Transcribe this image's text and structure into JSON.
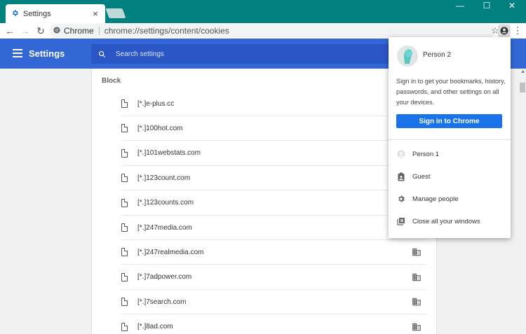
{
  "tab": {
    "title": "Settings",
    "close": "×"
  },
  "window_controls": {
    "minimize": "—",
    "maximize": "☐",
    "close": "✕"
  },
  "toolbar": {
    "back": "←",
    "forward": "→",
    "reload": "↻",
    "site_label": "Chrome",
    "url": "chrome://settings/content/cookies",
    "star": "☆",
    "menu": "⋮"
  },
  "header": {
    "title": "Settings",
    "search_placeholder": "Search settings"
  },
  "content": {
    "section_label": "Block",
    "sites": [
      "[*.]e-plus.cc",
      "[*.]100hot.com",
      "[*.]101webstats.com",
      "[*.]123count.com",
      "[*.]123counts.com",
      "[*.]247media.com",
      "[*.]247realmedia.com",
      "[*.]7adpower.com",
      "[*.]7search.com",
      "[*.]8ad.com"
    ]
  },
  "profile_popup": {
    "person_name": "Person 2",
    "signin_text": "Sign in to get your bookmarks, history, passwords, and other settings on all your devices.",
    "signin_button": "Sign in to Chrome",
    "items": [
      {
        "label": "Person 1",
        "icon": "person-avatar-icon"
      },
      {
        "label": "Guest",
        "icon": "guest-badge-icon"
      },
      {
        "label": "Manage people",
        "icon": "gear-icon"
      },
      {
        "label": "Close all your windows",
        "icon": "close-windows-icon"
      }
    ]
  },
  "colors": {
    "titlebar": "#00807f",
    "header": "#3367d6",
    "search": "#2a56c6",
    "signin_button": "#1a73e8"
  }
}
